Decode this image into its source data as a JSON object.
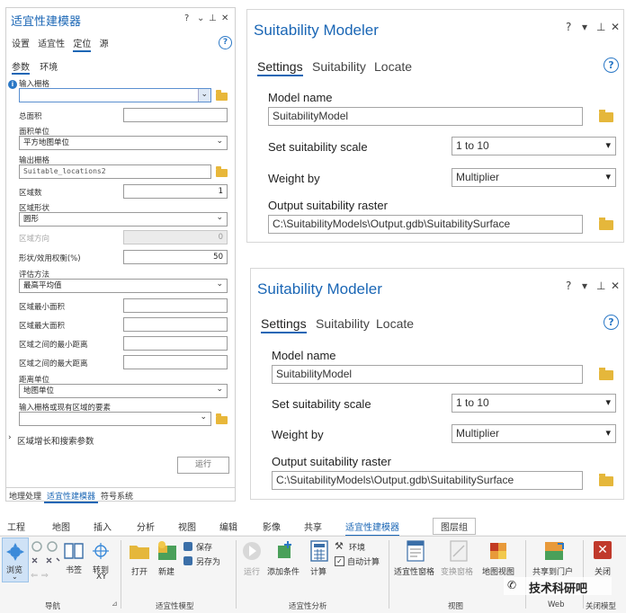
{
  "gp_pane": {
    "title": "适宜性建模器",
    "controls": [
      "?",
      "⌄",
      "⊥",
      "✕"
    ],
    "tabs": [
      "设置",
      "适宜性",
      "定位",
      "源"
    ],
    "active_tab": "定位",
    "subtabs": [
      "参数",
      "环境"
    ],
    "active_subtab": "参数",
    "input_raster_label": "输入栅格",
    "total_area_label": "总面积",
    "area_units_label": "面积单位",
    "area_units_value": "平方地图单位",
    "output_raster_label": "输出栅格",
    "output_raster_value": "Suitable_locations2",
    "region_count_label": "区域数",
    "region_count_value": "1",
    "region_shape_label": "区域形状",
    "region_shape_value": "圆形",
    "region_orientation_label": "区域方向",
    "region_orientation_value": "0",
    "shape_utility_label": "形状/效用权衡(%)",
    "shape_utility_value": "50",
    "eval_method_label": "评估方法",
    "eval_method_value": "最高平均值",
    "min_area_label": "区域最小面积",
    "max_area_label": "区域最大面积",
    "min_dist_label": "区域之间的最小距离",
    "max_dist_label": "区域之间的最大距离",
    "dist_units_label": "距离单位",
    "dist_units_value": "地图单位",
    "existing_regions_label": "输入栅格或现有区域的要素",
    "growth_section_label": "区域增长和搜索参数",
    "run_label": "运行",
    "bottom_tabs": [
      "地理处理",
      "适宜性建模器",
      "符号系统"
    ],
    "active_bottom_tab": "适宜性建模器"
  },
  "en_panes": [
    {
      "title": "Suitability Modeler",
      "controls": [
        "?",
        "▾",
        "⊥",
        "✕"
      ],
      "tabs": [
        "Settings",
        "Suitability",
        "Locate"
      ],
      "model_name_label": "Model name",
      "model_name_value": "SuitabilityModel",
      "scale_label": "Set suitability scale",
      "scale_value": "1 to 10",
      "weight_label": "Weight by",
      "weight_value": "Multiplier",
      "output_label": "Output suitability raster",
      "output_value": "C:\\SuitabilityModels\\Output.gdb\\SuitabilitySurface"
    },
    {
      "title": "Suitability Modeler",
      "controls": [
        "?",
        "▾",
        "⊥",
        "✕"
      ],
      "tabs": [
        "Settings",
        "Suitability",
        "Locate"
      ],
      "model_name_label": "Model name",
      "model_name_value": "SuitabilityModel",
      "scale_label": "Set suitability scale",
      "scale_value": "1 to 10",
      "weight_label": "Weight by",
      "weight_value": "Multiplier",
      "output_label": "Output suitability raster",
      "output_value": "C:\\SuitabilityModels\\Output.gdb\\SuitabilitySurface"
    }
  ],
  "ribbon": {
    "menu": [
      "工程",
      "地图",
      "插入",
      "分析",
      "视图",
      "编辑",
      "影像",
      "共享",
      "适宜性建模器",
      "图层组"
    ],
    "active_menu": "适宜性建模器",
    "buttons": {
      "browse": "浏览",
      "bookmark": "书签",
      "goto": "转到",
      "goto_xy": "XY",
      "open": "打开",
      "new": "新建",
      "save": "保存",
      "save_as": "另存为",
      "run": "运行",
      "add_condition": "添加条件",
      "calculate": "计算",
      "environment": "环境",
      "auto_calc": "自动计算",
      "suit_pane": "适宜性窗格",
      "transform_pane": "变换窗格",
      "map_view": "地图视图",
      "share_portal": "共享到门户",
      "close": "关闭"
    },
    "groups": {
      "nav": "导航",
      "model": "适宜性模型",
      "analysis": "适宜性分析",
      "view": "视图",
      "web": "Web",
      "close_model": "关闭模型"
    },
    "watermark": "技术科研吧"
  },
  "colors": {
    "accent": "#1a66b5",
    "folder": "#e5b73b",
    "close_red": "#c0392b"
  }
}
